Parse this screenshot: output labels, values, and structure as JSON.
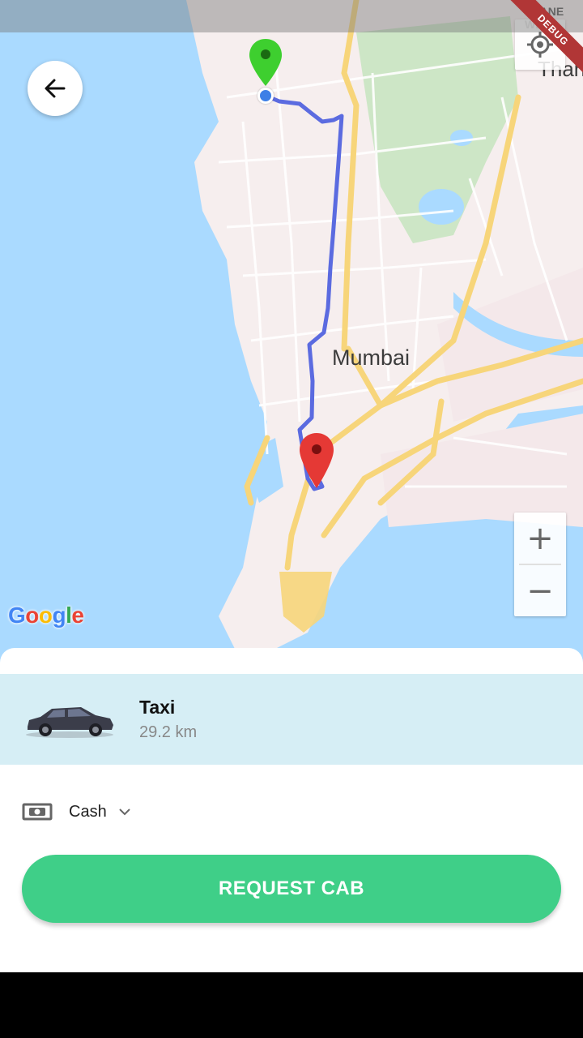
{
  "map": {
    "city_label": "Mumbai",
    "thane_label": "Than",
    "thane_west_label": "THANE WE",
    "provider": "Google",
    "zoom_in": "+",
    "zoom_out": "−"
  },
  "debug_banner": "DEBUG",
  "ride": {
    "name": "Taxi",
    "distance": "29.2 km"
  },
  "payment": {
    "method": "Cash"
  },
  "actions": {
    "request_label": "REQUEST CAB"
  },
  "colors": {
    "accent": "#3fcf88",
    "route": "#5b6be0",
    "pickup_pin": "#3ecf2f",
    "drop_pin": "#e53935"
  }
}
